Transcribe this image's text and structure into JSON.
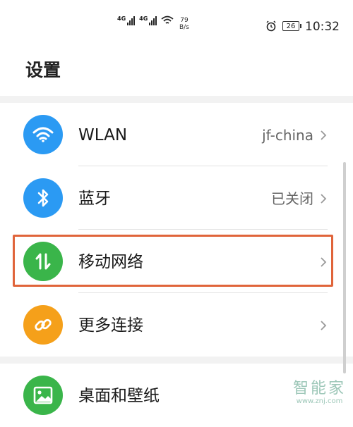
{
  "status_bar": {
    "signal1_label": "4G",
    "signal2_label": "4G",
    "speed_value": "79",
    "speed_unit": "B/s",
    "battery": "26",
    "time": "10:32",
    "icons": [
      "signal-icon",
      "signal-icon",
      "wifi-icon",
      "alarm-icon",
      "battery-icon"
    ]
  },
  "header": {
    "title": "设置"
  },
  "items": [
    {
      "label": "WLAN",
      "value": "jf-china",
      "icon": "wifi-icon",
      "color": "#2b9af3"
    },
    {
      "label": "蓝牙",
      "value": "已关闭",
      "icon": "bluetooth-icon",
      "color": "#2b9af3"
    },
    {
      "label": "移动网络",
      "value": "",
      "icon": "mobile-data-icon",
      "color": "#3ab54a",
      "highlighted": true
    },
    {
      "label": "更多连接",
      "value": "",
      "icon": "link-icon",
      "color": "#f5a01a"
    },
    {
      "label": "桌面和壁纸",
      "value": "",
      "icon": "wallpaper-icon",
      "color": "#3ab54a"
    }
  ],
  "watermark": {
    "title": "智能家",
    "url": "www.znj.com"
  },
  "colors": {
    "highlight": "#e0643a",
    "band": "#f2f2f2"
  }
}
